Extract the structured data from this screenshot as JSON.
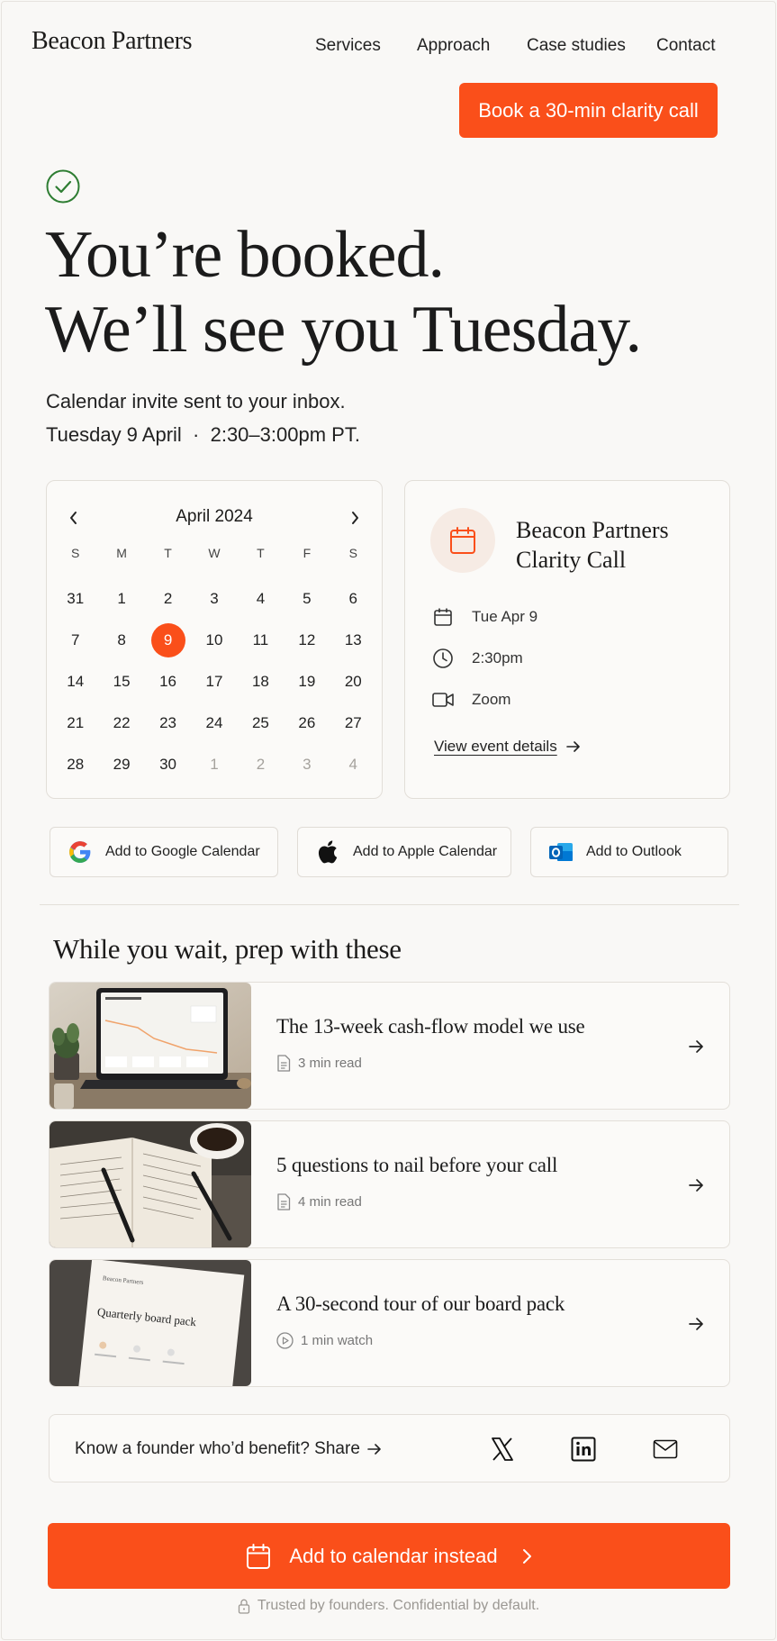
{
  "header": {
    "logo": "Beacon Partners",
    "nav": [
      "Services",
      "Approach",
      "Case studies",
      "Contact"
    ],
    "cta": "Book a 30-min clarity call"
  },
  "confirmation": {
    "headline_line1": "You’re booked.",
    "headline_line2": "We’ll see you Tuesday.",
    "sub1": "Calendar invite sent to your inbox.",
    "sub2": "Tuesday 9 April  ·  2:30–3:00pm PT."
  },
  "calendar": {
    "month": "April 2024",
    "weekdays": [
      "S",
      "M",
      "T",
      "W",
      "T",
      "F",
      "S"
    ],
    "weeks": [
      [
        "31",
        "1",
        "2",
        "3",
        "4",
        "5",
        "6"
      ],
      [
        "7",
        "8",
        "9",
        "10",
        "11",
        "12",
        "13"
      ],
      [
        "14",
        "15",
        "16",
        "17",
        "18",
        "19",
        "20"
      ],
      [
        "21",
        "22",
        "23",
        "24",
        "25",
        "26",
        "27"
      ],
      [
        "28",
        "29",
        "30",
        "1",
        "2",
        "3",
        "4"
      ]
    ],
    "selected": "9"
  },
  "event": {
    "title": "Beacon Partners Clarity Call",
    "date": "Tue Apr 9",
    "time": "2:30pm",
    "location": "Zoom",
    "details_link": "View event details"
  },
  "add_buttons": {
    "google": "Add to Google Calendar",
    "apple": "Add to Apple Calendar",
    "outlook": "Add to Outlook"
  },
  "prep": {
    "title": "While you wait, prep with these",
    "items": [
      {
        "title": "The 13-week cash-flow model we use",
        "meta": "3 min read",
        "thumb": "laptop-dashboard"
      },
      {
        "title": "5 questions to nail before your call",
        "meta": "4 min read",
        "thumb": "notebook-coffee"
      },
      {
        "title": "A 30-second tour of our board pack",
        "meta": "1 min watch",
        "thumb": "board-pack-document"
      }
    ],
    "thumb_label": "Quarterly board pack",
    "thumb_brand": "Beacon Partners"
  },
  "share": {
    "text": "Know a founder who’d benefit? Share"
  },
  "bottom": {
    "cta": "Add to calendar instead",
    "trust": "Trusted by founders. Confidential by default."
  },
  "colors": {
    "accent": "#fa4f1a",
    "success": "#2e7d32",
    "background": "#f9f8f6"
  }
}
